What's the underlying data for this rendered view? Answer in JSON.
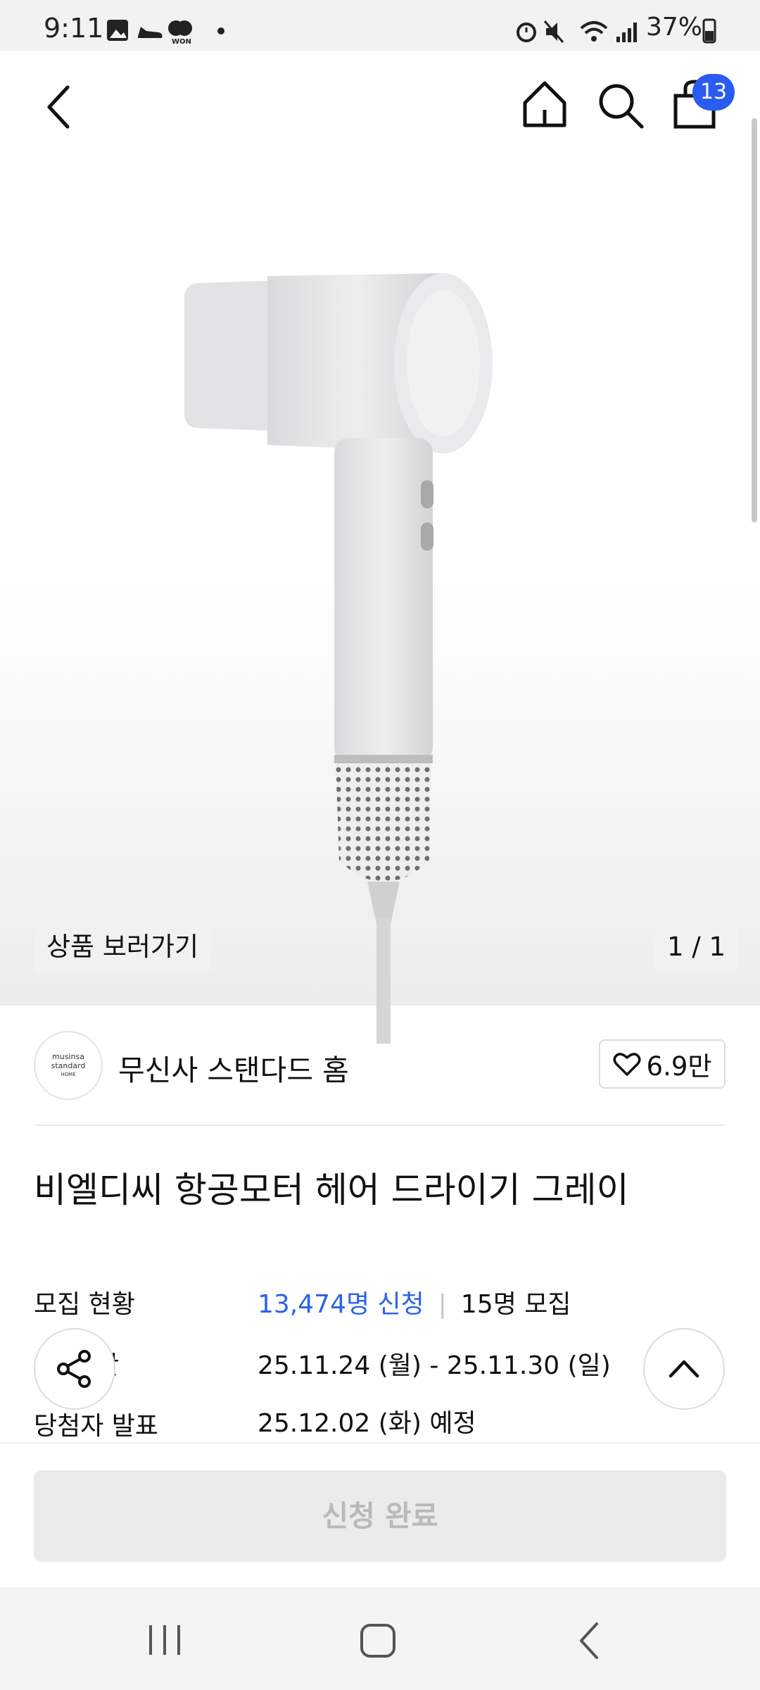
{
  "status_bar": {
    "time": "9:11",
    "battery": "37%",
    "left_icons": [
      "gallery-icon",
      "shoe-icon",
      "won-icon",
      "dot-icon"
    ],
    "right_icons": [
      "alarm-icon",
      "mute-icon",
      "wifi-icon",
      "signal-icon",
      "battery-icon"
    ]
  },
  "header": {
    "cart_count": "13",
    "icons": [
      "back-icon",
      "home-icon",
      "search-icon",
      "cart-icon"
    ]
  },
  "hero": {
    "view_product": "상품 보러가기",
    "counter": "1 / 1"
  },
  "brand": {
    "logo_line1": "musinsa",
    "logo_line2": "standard",
    "logo_line3": "HOME",
    "name": "무신사 스탠다드 홈",
    "likes": "6.9만"
  },
  "product": {
    "title": "비엘디씨 항공모터 헤어 드라이기 그레이"
  },
  "info": {
    "recruit_label": "모집 현황",
    "applicants": "13,474명 신청",
    "recruit_count": "15명 모집",
    "period_label_partial": "간",
    "period": "25.11.24 (월) - 25.11.30 (일)",
    "announce_label": "당첨자 발표",
    "announce": "25.12.02 (화) 예정"
  },
  "action": {
    "apply_label": "신청 완료"
  },
  "colors": {
    "accent": "#2b62e8",
    "badge": "#2a5bf0",
    "disabled_bg": "#ebebeb",
    "disabled_text": "#b9b9b9"
  }
}
